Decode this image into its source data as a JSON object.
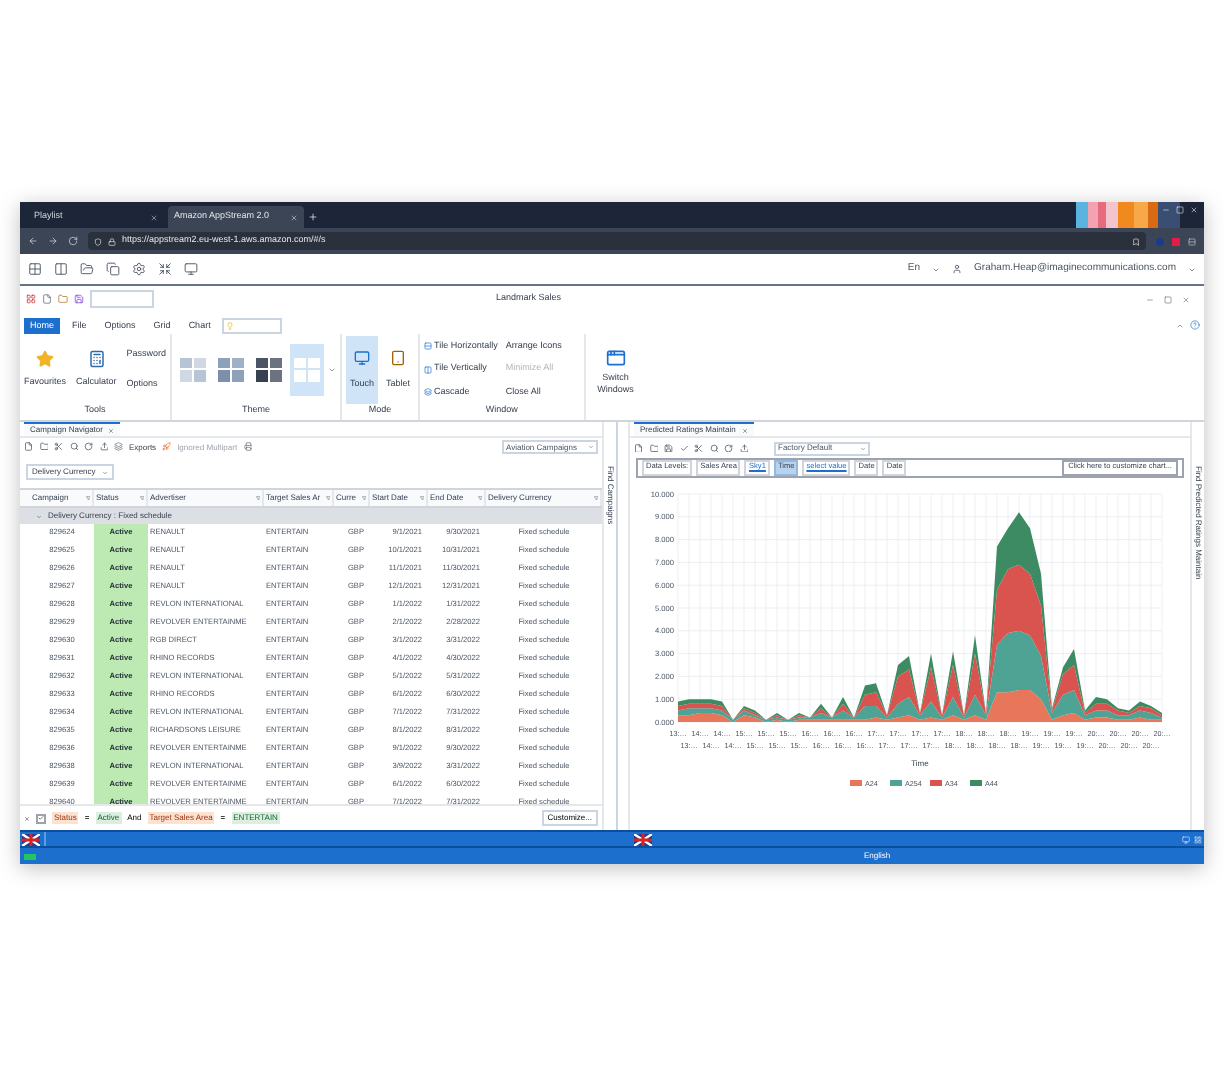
{
  "browser": {
    "tabs": [
      {
        "title": "Playlist",
        "selected": false
      },
      {
        "title": "Amazon AppStream 2.0",
        "selected": true
      }
    ],
    "url": "https://appstream2.eu-west-1.aws.amazon.com/#/s"
  },
  "session": {
    "language": "En",
    "user": "Graham.Heap@imaginecommunications.com"
  },
  "window": {
    "title": "Landmark Sales"
  },
  "ribbon": {
    "tabs": [
      {
        "label": "Home",
        "selected": true
      },
      {
        "label": "File",
        "selected": false
      },
      {
        "label": "Options",
        "selected": false
      },
      {
        "label": "Grid",
        "selected": false
      },
      {
        "label": "Chart",
        "selected": false
      }
    ],
    "tools": {
      "label": "Tools",
      "items": [
        {
          "label": "Favourites",
          "kind": "large"
        },
        {
          "label": "Calculator",
          "kind": "large"
        },
        {
          "label": "Password",
          "kind": "small"
        },
        {
          "label": "Options",
          "kind": "small"
        }
      ]
    },
    "theme": {
      "label": "Theme",
      "swatches": [
        {
          "selected": false
        },
        {
          "selected": false
        },
        {
          "selected": false
        },
        {
          "selected": true
        }
      ]
    },
    "mode": {
      "label": "Mode",
      "items": [
        {
          "label": "Touch",
          "selected": true
        },
        {
          "label": "Tablet",
          "selected": false
        }
      ]
    },
    "window_group": {
      "label": "Window",
      "items": [
        {
          "label": "Tile Horizontally",
          "disabled": false
        },
        {
          "label": "Tile Vertically",
          "disabled": false
        },
        {
          "label": "Cascade",
          "disabled": false
        },
        {
          "label": "Arrange Icons",
          "disabled": false
        },
        {
          "label": "Minimize All",
          "disabled": true
        },
        {
          "label": "Close All",
          "disabled": false
        }
      ],
      "switch": "Switch Windows"
    }
  },
  "campaign_panel": {
    "tab": "Campaign Navigator",
    "exports": "Exports",
    "multipart": "Ignored Multipart",
    "view": "Aviation Campaigns",
    "group_chip": "Delivery Currency",
    "side_label": "Find Campaigns",
    "columns": [
      "Campaign",
      "Status",
      "Advertiser",
      "Target Sales Ar",
      "Curre",
      "Start Date",
      "End Date",
      "Delivery Currency"
    ],
    "group_row": "Delivery Currency : Fixed schedule",
    "rows": [
      [
        "829624",
        "Active",
        "RENAULT",
        "ENTERTAIN",
        "GBP",
        "9/1/2021",
        "9/30/2021",
        "Fixed schedule"
      ],
      [
        "829625",
        "Active",
        "RENAULT",
        "ENTERTAIN",
        "GBP",
        "10/1/2021",
        "10/31/2021",
        "Fixed schedule"
      ],
      [
        "829626",
        "Active",
        "RENAULT",
        "ENTERTAIN",
        "GBP",
        "11/1/2021",
        "11/30/2021",
        "Fixed schedule"
      ],
      [
        "829627",
        "Active",
        "RENAULT",
        "ENTERTAIN",
        "GBP",
        "12/1/2021",
        "12/31/2021",
        "Fixed schedule"
      ],
      [
        "829628",
        "Active",
        "REVLON INTERNATIONAL",
        "ENTERTAIN",
        "GBP",
        "1/1/2022",
        "1/31/2022",
        "Fixed schedule"
      ],
      [
        "829629",
        "Active",
        "REVOLVER ENTERTAINME",
        "ENTERTAIN",
        "GBP",
        "2/1/2022",
        "2/28/2022",
        "Fixed schedule"
      ],
      [
        "829630",
        "Active",
        "RGB DIRECT",
        "ENTERTAIN",
        "GBP",
        "3/1/2022",
        "3/31/2022",
        "Fixed schedule"
      ],
      [
        "829631",
        "Active",
        "RHINO RECORDS",
        "ENTERTAIN",
        "GBP",
        "4/1/2022",
        "4/30/2022",
        "Fixed schedule"
      ],
      [
        "829632",
        "Active",
        "REVLON INTERNATIONAL",
        "ENTERTAIN",
        "GBP",
        "5/1/2022",
        "5/31/2022",
        "Fixed schedule"
      ],
      [
        "829633",
        "Active",
        "RHINO RECORDS",
        "ENTERTAIN",
        "GBP",
        "6/1/2022",
        "6/30/2022",
        "Fixed schedule"
      ],
      [
        "829634",
        "Active",
        "REVLON INTERNATIONAL",
        "ENTERTAIN",
        "GBP",
        "7/1/2022",
        "7/31/2022",
        "Fixed schedule"
      ],
      [
        "829635",
        "Active",
        "RICHARDSONS LEISURE",
        "ENTERTAIN",
        "GBP",
        "8/1/2022",
        "8/31/2022",
        "Fixed schedule"
      ],
      [
        "829636",
        "Active",
        "REVOLVER ENTERTAINME",
        "ENTERTAIN",
        "GBP",
        "9/1/2022",
        "9/30/2022",
        "Fixed schedule"
      ],
      [
        "829638",
        "Active",
        "REVLON INTERNATIONAL",
        "ENTERTAIN",
        "GBP",
        "3/9/2022",
        "3/31/2022",
        "Fixed schedule"
      ],
      [
        "829639",
        "Active",
        "REVOLVER ENTERTAINME",
        "ENTERTAIN",
        "GBP",
        "6/1/2022",
        "6/30/2022",
        "Fixed schedule"
      ],
      [
        "829640",
        "Active",
        "REVOLVER ENTERTAINME",
        "ENTERTAIN",
        "GBP",
        "7/1/2022",
        "7/31/2022",
        "Fixed schedule"
      ]
    ],
    "filter": {
      "conditions": [
        {
          "field": "Status",
          "op": "=",
          "value": "Active"
        },
        {
          "field": "Target Sales Area",
          "op": "=",
          "value": "ENTERTAIN"
        }
      ],
      "joiner": "And",
      "enabled": true
    },
    "customize": "Customize..."
  },
  "ratings_panel": {
    "tab": "Predicted Ratings Maintain",
    "layout": "Factory Default",
    "side_label": "Find Predicted Ratings Maintain",
    "levels_label": "Data Levels:",
    "levels": [
      {
        "label": "Sales Area",
        "kind": "button",
        "selected": false
      },
      {
        "label": "Sky1",
        "kind": "link",
        "selected": false
      },
      {
        "label": "Time",
        "kind": "button",
        "selected": true
      },
      {
        "label": "select value",
        "kind": "link",
        "selected": false
      },
      {
        "label": "Date",
        "kind": "button",
        "selected": false
      },
      {
        "label": "Date",
        "kind": "button",
        "selected": false
      }
    ],
    "customize": "Click here to customize chart...",
    "chart_data": {
      "type": "area",
      "stacked": true,
      "grid": true,
      "legend": "bottom",
      "xlabel": "Time",
      "ylim": [
        0,
        10
      ],
      "yticks": [
        {
          "value": 0,
          "label": "0.000"
        },
        {
          "value": 1,
          "label": "1.000"
        },
        {
          "value": 2,
          "label": "2.000"
        },
        {
          "value": 3,
          "label": "3.000"
        },
        {
          "value": 4,
          "label": "4.000"
        },
        {
          "value": 5,
          "label": "5.000"
        },
        {
          "value": 6,
          "label": "6.000"
        },
        {
          "value": 7,
          "label": "7.000"
        },
        {
          "value": 8,
          "label": "8.000"
        },
        {
          "value": 9,
          "label": "9.000"
        },
        {
          "value": 10,
          "label": "10.000"
        }
      ],
      "categories": [
        "13:…",
        "13:…",
        "14:…",
        "14:…",
        "14:…",
        "14:…",
        "15:…",
        "15:…",
        "15:…",
        "15:…",
        "15:…",
        "15:…",
        "16:…",
        "16:…",
        "16:…",
        "16:…",
        "16:…",
        "16:…",
        "17:…",
        "17:…",
        "17:…",
        "17:…",
        "17:…",
        "17:…",
        "17:…",
        "18:…",
        "18:…",
        "18:…",
        "18:…",
        "18:…",
        "18:…",
        "18:…",
        "19:…",
        "19:…",
        "19:…",
        "19:…",
        "19:…",
        "19:…",
        "20:…",
        "20:…",
        "20:…",
        "20:…",
        "20:…",
        "20:…",
        "20:…"
      ],
      "series": [
        {
          "name": "A24",
          "color": "#e8765a",
          "values": [
            0.3,
            0.3,
            0.4,
            0.4,
            0.3,
            0,
            0.3,
            0.2,
            0,
            0.1,
            0,
            0.1,
            0.1,
            0.1,
            0.1,
            0.1,
            0.1,
            0.1,
            0.2,
            0.1,
            0.2,
            0.3,
            0.1,
            0.2,
            0.1,
            0.3,
            0.1,
            0.3,
            0.1,
            1.3,
            1.3,
            1.4,
            1.4,
            1.0,
            0.1,
            0.3,
            0.4,
            0.1,
            0.2,
            0.2,
            0.1,
            0.1,
            0.2,
            0.1,
            0.1
          ]
        },
        {
          "name": "A254",
          "color": "#4fa394",
          "values": [
            0.2,
            0.3,
            0.2,
            0.2,
            0.2,
            0.1,
            0.2,
            0.1,
            0.1,
            0.1,
            0.1,
            0.1,
            0.1,
            0.3,
            0.1,
            0.4,
            0.1,
            0.6,
            0.5,
            0.1,
            0.6,
            0.8,
            0.2,
            0.7,
            0.1,
            0.8,
            0.1,
            0.9,
            0.2,
            2.1,
            2.6,
            2.6,
            2.4,
            1.9,
            0.3,
            0.9,
            1.0,
            0.2,
            0.3,
            0.3,
            0.2,
            0.2,
            0.3,
            0.3,
            0.1
          ]
        },
        {
          "name": "A34",
          "color": "#d9534f",
          "values": [
            0.2,
            0.2,
            0.2,
            0.2,
            0.2,
            0,
            0.1,
            0.1,
            0,
            0.1,
            0,
            0.1,
            0,
            0.2,
            0,
            0.3,
            0,
            0.5,
            0.6,
            0.1,
            1.2,
            1.2,
            0.1,
            1.5,
            0.1,
            1.4,
            0.1,
            1.8,
            0.1,
            2.4,
            2.8,
            2.9,
            2.7,
            2.2,
            0.1,
            0.9,
            1.1,
            0.1,
            0.3,
            0.3,
            0.2,
            0.1,
            0.2,
            0.2,
            0.1
          ]
        },
        {
          "name": "A44",
          "color": "#3d8b63",
          "values": [
            0.2,
            0.2,
            0.2,
            0.2,
            0.2,
            0,
            0.1,
            0.1,
            0,
            0.1,
            0,
            0.1,
            0,
            0.2,
            0,
            0.3,
            0,
            0.4,
            0.4,
            0,
            0.5,
            0.6,
            0,
            0.6,
            0,
            0.6,
            0,
            0.8,
            0,
            1.9,
            1.8,
            2.3,
            2.0,
            1.4,
            0.1,
            0.3,
            0.7,
            0.1,
            0.3,
            0.2,
            0.1,
            0.1,
            0.2,
            0.1,
            0.1
          ]
        }
      ]
    }
  },
  "status_bar": {
    "language": "English"
  }
}
